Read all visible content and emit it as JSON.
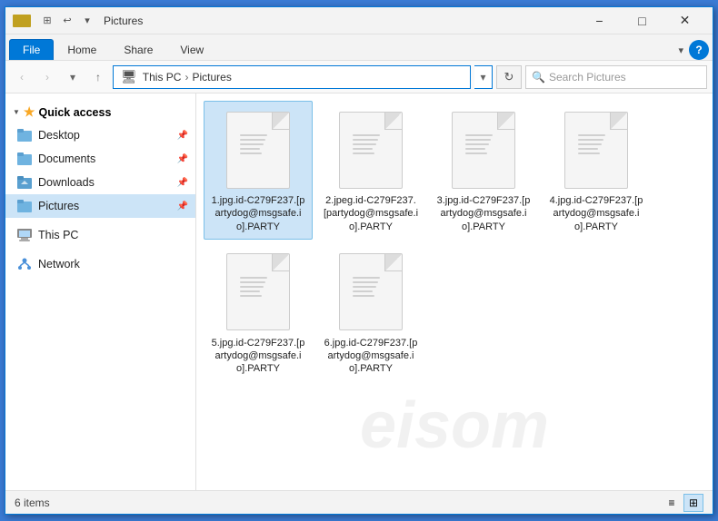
{
  "window": {
    "title": "Pictures",
    "minimize_label": "−",
    "maximize_label": "□",
    "close_label": "✕"
  },
  "ribbon": {
    "tabs": [
      "File",
      "Home",
      "Share",
      "View"
    ],
    "active_tab": "File",
    "help_label": "?"
  },
  "qat": {
    "props_label": "⊞",
    "undo_label": "↩",
    "dropdown_label": "▾"
  },
  "address": {
    "back_label": "‹",
    "forward_label": "›",
    "up_label": "↑",
    "this_pc": "This PC",
    "separator": "›",
    "current": "Pictures",
    "dropdown_label": "▾",
    "refresh_label": "↻",
    "search_placeholder": "Search Pictures"
  },
  "sidebar": {
    "quick_access_label": "Quick access",
    "desktop_label": "Desktop",
    "documents_label": "Documents",
    "downloads_label": "Downloads",
    "pictures_label": "Pictures",
    "this_pc_label": "This PC",
    "network_label": "Network"
  },
  "files": [
    {
      "name": "1.jpg.id-C279F237.[partydog@msgsafe.io].PARTY"
    },
    {
      "name": "2.jpeg.id-C279F237.[partydog@msgsafe.io].PARTY"
    },
    {
      "name": "3.jpg.id-C279F237.[partydog@msgsafe.io].PARTY"
    },
    {
      "name": "4.jpg.id-C279F237.[partydog@msgsafe.io].PARTY"
    },
    {
      "name": "5.jpg.id-C279F237.[partydog@msgsafe.io].PARTY"
    },
    {
      "name": "6.jpg.id-C279F237.[partydog@msgsafe.io].PARTY"
    }
  ],
  "status": {
    "count_label": "6 items"
  },
  "watermark": "eisom",
  "view": {
    "details_label": "≡",
    "icons_label": "⊞"
  }
}
